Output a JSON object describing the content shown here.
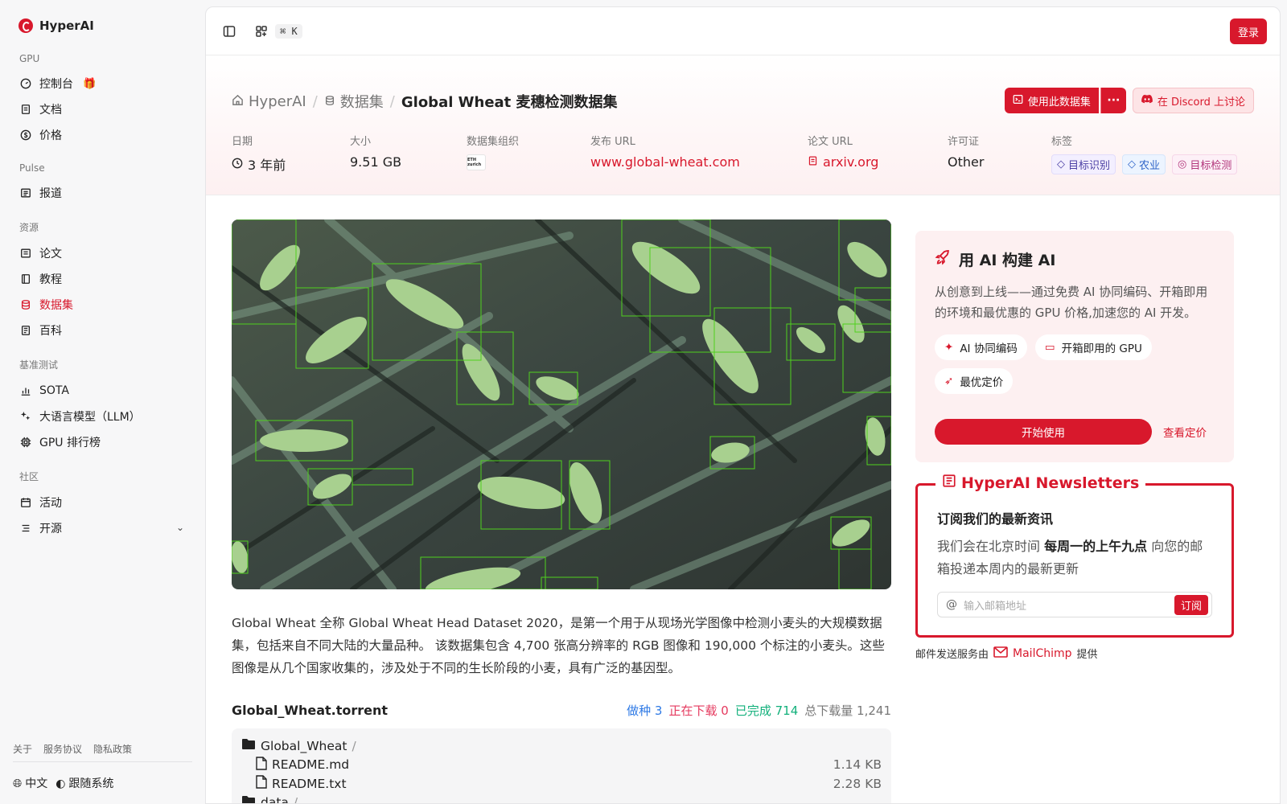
{
  "brand": {
    "name": "HyperAI"
  },
  "sidebar": {
    "sections": [
      {
        "title": "GPU"
      },
      {
        "title": "Pulse"
      },
      {
        "title": "资源"
      },
      {
        "title": "基准测试"
      },
      {
        "title": "社区"
      }
    ],
    "items": {
      "console": "控制台",
      "docs": "文档",
      "pricing": "价格",
      "news": "报道",
      "papers": "论文",
      "tutorials": "教程",
      "datasets": "数据集",
      "wiki": "百科",
      "sota": "SOTA",
      "llm": "大语言模型（LLM）",
      "gpu_rank": "GPU 排行榜",
      "events": "活动",
      "opensource": "开源"
    },
    "footer_links": [
      "关于",
      "服务协议",
      "隐私政策"
    ],
    "language": "中文",
    "theme": "跟随系统"
  },
  "topbar": {
    "shortcut": "⌘ K",
    "login": "登录"
  },
  "breadcrumb": {
    "home": "HyperAI",
    "section": "数据集",
    "current": "Global Wheat 麦穗检测数据集"
  },
  "actions": {
    "use_dataset": "使用此数据集",
    "more": "···",
    "discord": "在 Discord 上讨论"
  },
  "meta": {
    "date_label": "日期",
    "date_value": "3 年前",
    "size_label": "大小",
    "size_value": "9.51 GB",
    "org_label": "数据集组织",
    "org_logo_text": "ETH zurich",
    "url_label": "发布 URL",
    "url_value": "www.global-wheat.com",
    "paper_label": "论文 URL",
    "paper_value": "arxiv.org",
    "license_label": "许可证",
    "license_value": "Other",
    "tags_label": "标签",
    "tags": [
      "目标识别",
      "农业",
      "目标检测"
    ]
  },
  "description": "Global Wheat 全称 Global Wheat Head Dataset 2020，是第一个用于从现场光学图像中检测小麦头的大规模数据集，包括来自不同大陆的大量品种。 该数据集包含 4,700 张高分辨率的 RGB 图像和 190,000 个标注的小麦头。这些图像是从几个国家收集的，涉及处于不同的生长阶段的小麦，具有广泛的基因型。",
  "torrent": {
    "name": "Global_Wheat.torrent",
    "seeding_label": "做种",
    "seeding": "3",
    "downloading_label": "正在下载",
    "downloading": "0",
    "completed_label": "已完成",
    "completed": "714",
    "total_label": "总下载量",
    "total": "1,241",
    "files": [
      {
        "name": "Global_Wheat",
        "type": "folder",
        "size": ""
      },
      {
        "name": "README.md",
        "type": "file",
        "size": "1.14 KB"
      },
      {
        "name": "README.txt",
        "type": "file",
        "size": "2.28 KB"
      },
      {
        "name": "data",
        "type": "folder",
        "size": ""
      }
    ]
  },
  "promo": {
    "title": "用 AI 构建 AI",
    "desc": "从创意到上线——通过免费 AI 协同编码、开箱即用的环境和最优惠的 GPU 价格,加速您的 AI 开发。",
    "chips": [
      "AI 协同编码",
      "开箱即用的 GPU",
      "最优定价"
    ],
    "start": "开始使用",
    "pricing": "查看定价"
  },
  "newsletter": {
    "title": "HyperAI Newsletters",
    "heading": "订阅我们的最新资讯",
    "text_pre": "我们会在北京时间 ",
    "text_bold": "每周一的上午九点",
    "text_post": " 向您的邮箱投递本周内的最新更新",
    "placeholder": "输入邮箱地址",
    "button": "订阅"
  },
  "mailchimp": {
    "prefix": "邮件发送服务由",
    "name": "MailChimp",
    "suffix": "提供"
  },
  "colors": {
    "accent": "#d8182c"
  }
}
